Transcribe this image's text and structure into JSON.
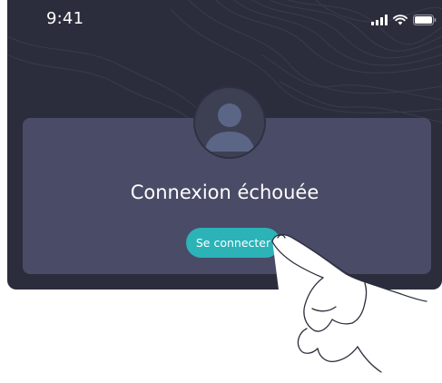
{
  "status_bar": {
    "time": "9:41",
    "icons": [
      "signal-icon",
      "wifi-icon",
      "battery-icon"
    ]
  },
  "dialog": {
    "avatar_icon": "user-avatar-icon",
    "title": "Connexion échouée",
    "button_label": "Se connecter"
  },
  "decoration": {
    "pointer": "pointing-hand-illustration"
  },
  "colors": {
    "screen_background": "#2b2d3c",
    "card_background": "#4a4b66",
    "button_accent": "#2bb3b8",
    "text": "#ffffff"
  }
}
